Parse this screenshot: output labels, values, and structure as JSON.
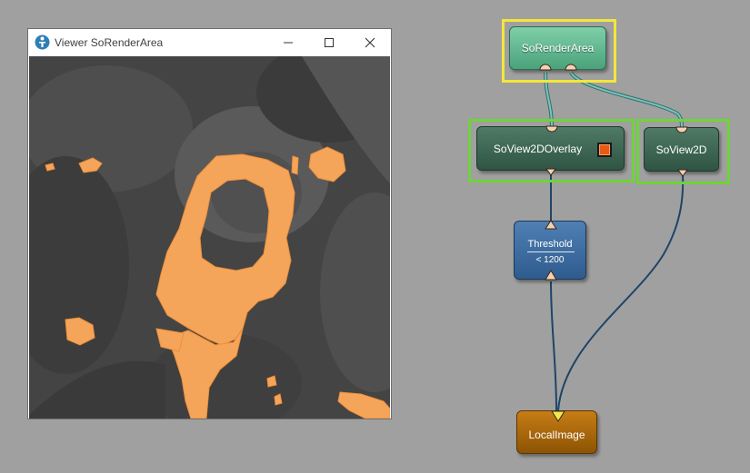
{
  "viewer": {
    "title": "Viewer SoRenderArea",
    "icon": "mevislab-app-icon",
    "controls": [
      "minimize-icon",
      "maximize-icon",
      "close-icon"
    ],
    "image": {
      "description_visible": "grayscale medical slice with orange threshold overlay",
      "overlay_color": "#f5a55a"
    }
  },
  "network": {
    "modules": [
      {
        "id": "sorenderarea",
        "label": "SoRenderArea",
        "color": "#5fb88f",
        "selected": "yellow"
      },
      {
        "id": "soview2doverlay",
        "label": "SoView2DOverlay",
        "color": "#3d6555",
        "selected": "green",
        "overlay_swatch": "#e85a10"
      },
      {
        "id": "soview2d",
        "label": "SoView2D",
        "color": "#3d6555",
        "selected": "green"
      },
      {
        "id": "threshold",
        "label": "Threshold",
        "sublabel": "< 1200",
        "color": "#3e6ea2"
      },
      {
        "id": "localimage",
        "label": "LocalImage",
        "color": "#a8660b"
      }
    ],
    "connections": [
      {
        "from": "soview2doverlay",
        "to": "sorenderarea",
        "color": "#5fa6a0"
      },
      {
        "from": "soview2d",
        "to": "sorenderarea",
        "color": "#5fa6a0"
      },
      {
        "from": "threshold",
        "to": "soview2doverlay",
        "color": "#1f4468"
      },
      {
        "from": "localimage",
        "to": "threshold",
        "color": "#1f4468"
      },
      {
        "from": "localimage",
        "to": "soview2d",
        "color": "#1f4468"
      }
    ],
    "colors": {
      "background": "#a0a0a0",
      "selection_yellow": "#f4e63a",
      "selection_green": "#6fd33b",
      "connector": "#f3d2b3"
    }
  }
}
